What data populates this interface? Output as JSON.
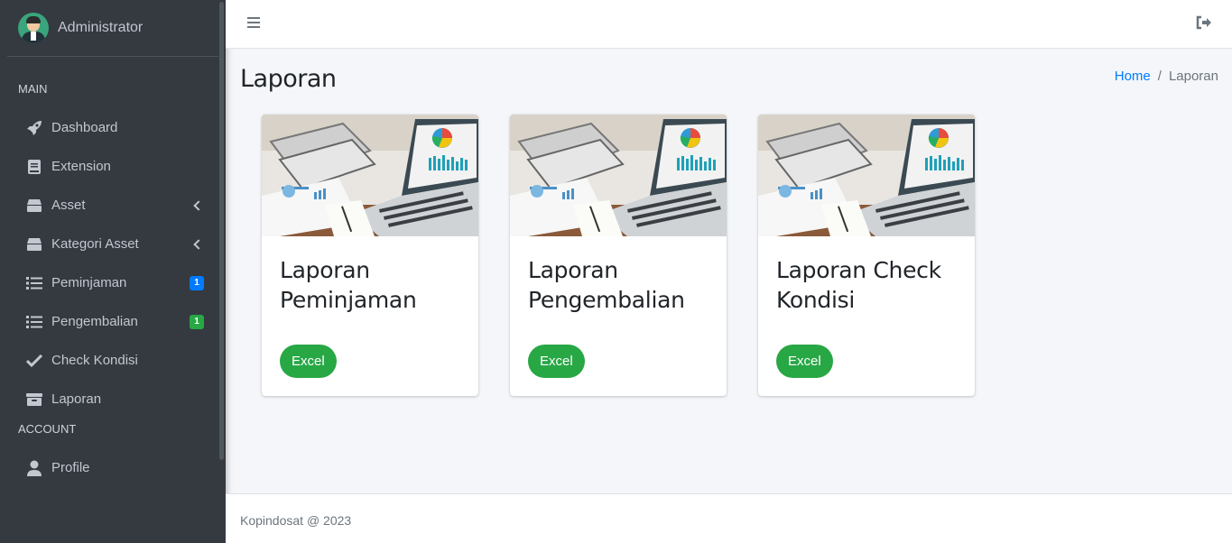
{
  "sidebar": {
    "user_name": "Administrator",
    "section_main": "MAIN",
    "section_account": "ACCOUNT",
    "items": [
      {
        "label": "Dashboard",
        "icon": "rocket-icon"
      },
      {
        "label": "Extension",
        "icon": "book-icon"
      },
      {
        "label": "Asset",
        "icon": "box-icon",
        "has_submenu": true
      },
      {
        "label": "Kategori Asset",
        "icon": "box-icon",
        "has_submenu": true
      },
      {
        "label": "Peminjaman",
        "icon": "list-icon",
        "badge": "1",
        "badge_color": "#007bff"
      },
      {
        "label": "Pengembalian",
        "icon": "list-icon",
        "badge": "1",
        "badge_color": "#28a745"
      },
      {
        "label": "Check Kondisi",
        "icon": "check-icon"
      },
      {
        "label": "Laporan",
        "icon": "archive-icon"
      }
    ],
    "account_items": [
      {
        "label": "Profile",
        "icon": "user-icon"
      }
    ]
  },
  "topbar": {
    "menu_icon": "hamburger-icon",
    "logout_icon": "sign-out-icon"
  },
  "page": {
    "title": "Laporan",
    "breadcrumb": {
      "home": "Home",
      "separator": "/",
      "current": "Laporan"
    }
  },
  "cards": [
    {
      "title": "Laporan Peminjaman",
      "button": "Excel"
    },
    {
      "title": "Laporan Pengembalian",
      "button": "Excel"
    },
    {
      "title": "Laporan Check Kondisi",
      "button": "Excel"
    }
  ],
  "footer": {
    "text": "Kopindosat @ 2023"
  },
  "colors": {
    "sidebar_bg": "#343a40",
    "accent_blue": "#007bff",
    "success_green": "#28a745"
  }
}
